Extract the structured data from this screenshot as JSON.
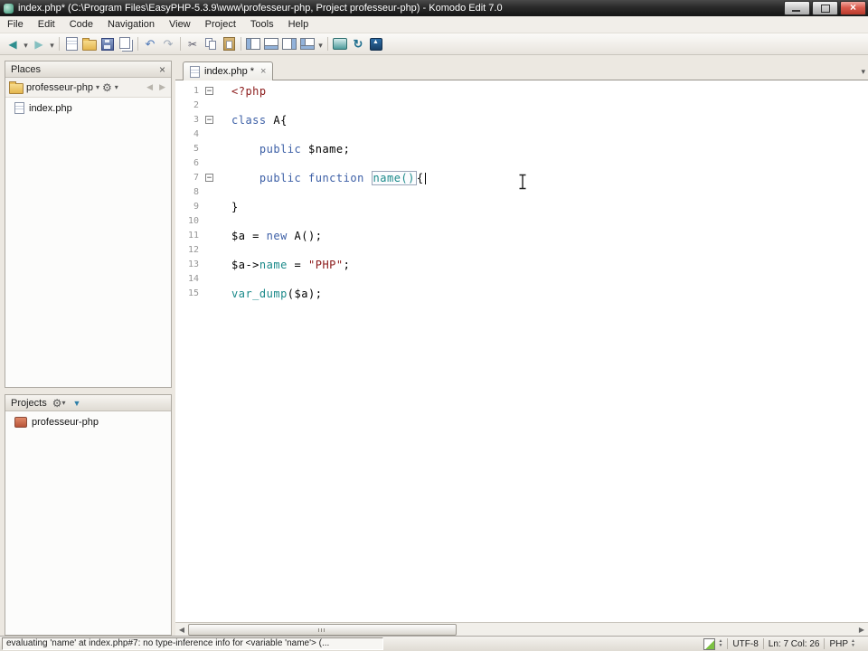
{
  "window": {
    "title": "index.php* (C:\\Program Files\\EasyPHP-5.3.9\\www\\professeur-php, Project professeur-php) - Komodo Edit 7.0"
  },
  "menubar": {
    "items": [
      "File",
      "Edit",
      "Code",
      "Navigation",
      "View",
      "Project",
      "Tools",
      "Help"
    ]
  },
  "toolbar": {
    "buttons": [
      {
        "name": "back-button",
        "icon": "arrow-left"
      },
      {
        "name": "back-history-dropdown",
        "icon": "drop"
      },
      {
        "name": "forward-button",
        "icon": "arrow-right"
      },
      {
        "name": "forward-history-dropdown",
        "icon": "drop"
      },
      {
        "name": "toolbar-separator-1",
        "icon": "sep"
      },
      {
        "name": "new-file-button",
        "icon": "page"
      },
      {
        "name": "open-file-button",
        "icon": "folder"
      },
      {
        "name": "save-button",
        "icon": "save"
      },
      {
        "name": "save-all-button",
        "icon": "pages"
      },
      {
        "name": "toolbar-separator-2",
        "icon": "sep"
      },
      {
        "name": "undo-button",
        "icon": "undo"
      },
      {
        "name": "redo-button",
        "icon": "redo"
      },
      {
        "name": "toolbar-separator-3",
        "icon": "sep"
      },
      {
        "name": "cut-button",
        "icon": "cut"
      },
      {
        "name": "copy-button",
        "icon": "copy"
      },
      {
        "name": "paste-button",
        "icon": "paste"
      },
      {
        "name": "toolbar-separator-4",
        "icon": "sep"
      },
      {
        "name": "show-left-pane-button",
        "icon": "pane-left"
      },
      {
        "name": "show-bottom-pane-button",
        "icon": "pane-bottom"
      },
      {
        "name": "show-right-pane-button",
        "icon": "pane-right"
      },
      {
        "name": "show-all-panes-button",
        "icon": "pane-all"
      },
      {
        "name": "panes-dropdown",
        "icon": "drop"
      },
      {
        "name": "toolbar-separator-5",
        "icon": "sep"
      },
      {
        "name": "preview-in-browser-button",
        "icon": "preview"
      },
      {
        "name": "sync-button",
        "icon": "sync"
      },
      {
        "name": "publish-button",
        "icon": "publish"
      }
    ]
  },
  "places": {
    "title": "Places",
    "current_folder": "professeur-php",
    "tree": [
      {
        "label": "index.php"
      }
    ]
  },
  "projects": {
    "title": "Projects",
    "items": [
      {
        "label": "professeur-php"
      }
    ]
  },
  "editor": {
    "tab": {
      "label": "index.php *"
    },
    "syntax_colors": {
      "kw": "#3C5FA6",
      "name": "#1B8A8A",
      "str": "#8B1A1A",
      "tag": "#8B1A1A",
      "plain": "#000000",
      "soft": "#000000"
    },
    "code": {
      "lines": [
        {
          "n": 1,
          "fold": true,
          "tokens": [
            {
              "c": "tag",
              "t": "<?php"
            }
          ]
        },
        {
          "n": 2,
          "fold": false,
          "tokens": []
        },
        {
          "n": 3,
          "fold": true,
          "tokens": [
            {
              "c": "kw",
              "t": "class"
            },
            {
              "c": "plain",
              "t": " A{"
            }
          ]
        },
        {
          "n": 4,
          "fold": false,
          "tokens": []
        },
        {
          "n": 5,
          "fold": false,
          "tokens": [
            {
              "c": "plain",
              "t": "    "
            },
            {
              "c": "kw",
              "t": "public"
            },
            {
              "c": "plain",
              "t": " $name;"
            }
          ]
        },
        {
          "n": 6,
          "fold": false,
          "tokens": []
        },
        {
          "n": 7,
          "fold": true,
          "tokens": [
            {
              "c": "plain",
              "t": "    "
            },
            {
              "c": "kw",
              "t": "public"
            },
            {
              "c": "plain",
              "t": " "
            },
            {
              "c": "kw",
              "t": "function"
            },
            {
              "c": "plain",
              "t": " "
            },
            {
              "c": "name",
              "t": "name()",
              "box": true
            },
            {
              "c": "soft",
              "t": "{"
            },
            {
              "c": "caret",
              "t": ""
            }
          ]
        },
        {
          "n": 8,
          "fold": false,
          "tokens": []
        },
        {
          "n": 9,
          "fold": false,
          "tokens": [
            {
              "c": "plain",
              "t": "}"
            }
          ]
        },
        {
          "n": 10,
          "fold": false,
          "tokens": []
        },
        {
          "n": 11,
          "fold": false,
          "tokens": [
            {
              "c": "plain",
              "t": "$a = "
            },
            {
              "c": "kw",
              "t": "new"
            },
            {
              "c": "plain",
              "t": " A();"
            }
          ]
        },
        {
          "n": 12,
          "fold": false,
          "tokens": []
        },
        {
          "n": 13,
          "fold": false,
          "tokens": [
            {
              "c": "plain",
              "t": "$a->"
            },
            {
              "c": "name",
              "t": "name"
            },
            {
              "c": "plain",
              "t": " = "
            },
            {
              "c": "str",
              "t": "\"PHP\""
            },
            {
              "c": "plain",
              "t": ";"
            }
          ]
        },
        {
          "n": 14,
          "fold": false,
          "tokens": []
        },
        {
          "n": 15,
          "fold": false,
          "tokens": [
            {
              "c": "name",
              "t": "var_dump"
            },
            {
              "c": "plain",
              "t": "($a);"
            }
          ]
        }
      ]
    }
  },
  "statusbar": {
    "message": "evaluating 'name' at index.php#7: no type-inference info for <variable 'name'> (...",
    "encoding": "UTF-8",
    "cursor_position": "Ln: 7 Col: 26",
    "language": "PHP"
  }
}
